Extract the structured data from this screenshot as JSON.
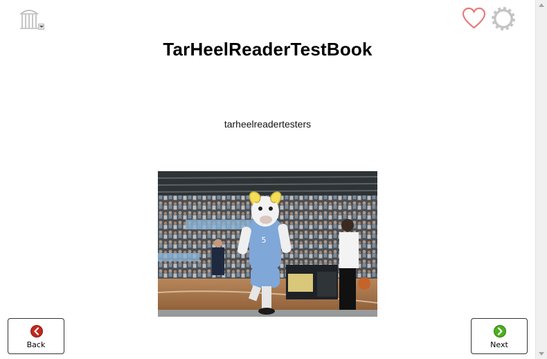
{
  "book": {
    "title": "TarHeelReaderTestBook",
    "author": "tarheelreadertesters"
  },
  "photo": {
    "jersey_number": "5"
  },
  "nav": {
    "back_label": "Back",
    "next_label": "Next"
  },
  "icons": {
    "logo": "old-well-logo-icon",
    "favorite": "heart-icon",
    "settings": "gear-icon",
    "back": "back-arrow-icon",
    "next": "next-arrow-icon"
  },
  "colors": {
    "heart": "#e8797a",
    "gear": "#c4c4c4",
    "back_button": "#c0281e",
    "next_button": "#4caf1c"
  }
}
